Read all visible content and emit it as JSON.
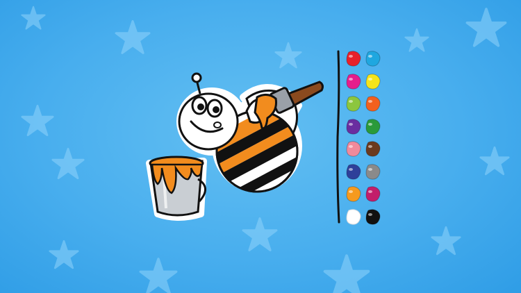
{
  "background_color": "#48aeee",
  "star_color": "#8fd3fb",
  "artwork": {
    "subject": "bee-painting-icon",
    "paint_color": "#f28c1e",
    "stripe_color": "#111111"
  },
  "palette": {
    "colors": [
      "#e8202a",
      "#1fa7e0",
      "#e61e8c",
      "#f5e41a",
      "#8cc63e",
      "#f2601e",
      "#6a2ea0",
      "#2a9a3a",
      "#f08a9c",
      "#6b3a1e",
      "#2e3f9a",
      "#8a8a8a",
      "#f59a1e",
      "#c21e6a",
      "#ffffff",
      "#111111"
    ]
  }
}
